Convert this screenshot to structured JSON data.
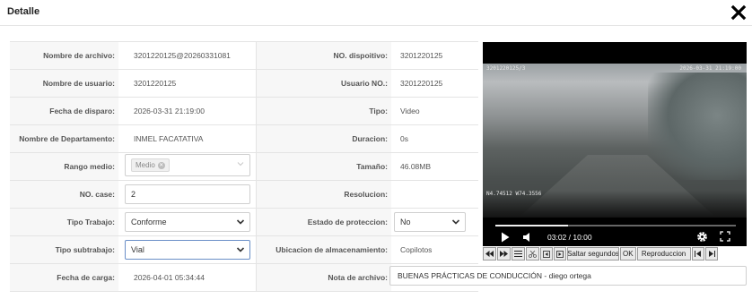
{
  "dialog": {
    "title": "Detalle",
    "close_icon": "close-x-icon"
  },
  "fields": {
    "nombre_archivo": {
      "label": "Nombre de archivo:",
      "value": "3201220125@20260331081"
    },
    "nombre_usuario": {
      "label": "Nombre de usuario:",
      "value": "3201220125"
    },
    "fecha_disparo": {
      "label": "Fecha de disparo:",
      "value": "2026-03-31 21:19:00"
    },
    "nombre_departamento": {
      "label": "Nombre de Departamento:",
      "value": "INMEL FACATATIVA"
    },
    "rango_medio": {
      "label": "Rango medio:",
      "tag": "Medio"
    },
    "no_case": {
      "label": "NO. case:",
      "value": "2"
    },
    "tipo_trabajo": {
      "label": "Tipo Trabajo:",
      "value": "Conforme"
    },
    "tipo_subtrabajo": {
      "label": "Tipo subtrabajo:",
      "value": "Vial"
    },
    "fecha_carga": {
      "label": "Fecha de carga:",
      "value": "2026-04-01 05:34:44"
    },
    "no_dispositivo": {
      "label": "NO. dispoitivo:",
      "value": "3201220125"
    },
    "usuario_no": {
      "label": "Usuario NO.:",
      "value": "3201220125"
    },
    "tipo": {
      "label": "Tipo:",
      "value": "Video"
    },
    "duracion": {
      "label": "Duracion:",
      "value": "0s"
    },
    "tamano": {
      "label": "Tamaño:",
      "value": "46.08MB"
    },
    "resolucion": {
      "label": "Resolucion:",
      "value": ""
    },
    "estado_proteccion": {
      "label": "Estado de proteccion:",
      "value": "No"
    },
    "ubicacion": {
      "label": "Ubicacion de almacenamiento:",
      "value": "Copilotos"
    },
    "nota_archivo": {
      "label": "Nota de archivo:",
      "value": "BUENAS PRÁCTICAS DE CONDUCCIÓN - diego ortega"
    }
  },
  "player": {
    "time": "03:02 / 10:00",
    "progress": 0.303,
    "osd_top_left": "3201220125/3",
    "osd_top_right": "2026-03-31 21:19:00",
    "osd_bottom_left": "N4.74512 W74.3556"
  },
  "toolbar": {
    "skip_seconds_label": "Saltar segundos",
    "ok_label": "OK",
    "playback_label": "Reproduccion"
  },
  "colors": {
    "label_bg": "#f7f7f7",
    "border": "#e4e4e4",
    "focus_border": "#6a8fc7",
    "video_bg": "#000000"
  }
}
